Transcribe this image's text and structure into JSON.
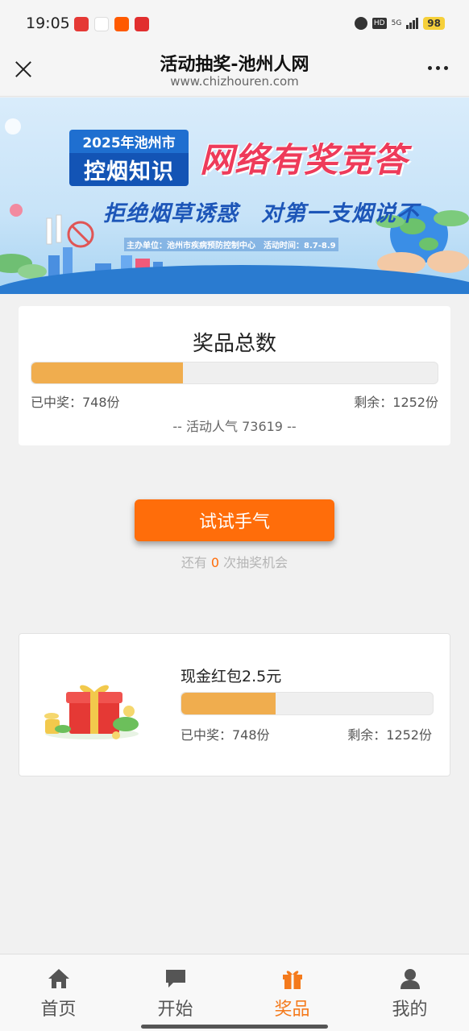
{
  "status_bar": {
    "time": "19:05",
    "network": "5G",
    "battery": "98",
    "hd": "HD",
    "app_icons": [
      "toutiao-icon",
      "app-avatar-icon",
      "taobao-icon",
      "stock-app-icon"
    ]
  },
  "header": {
    "title": "活动抽奖-池州人网",
    "subtitle": "www.chizhouren.com"
  },
  "banner": {
    "year_line": "2025年池州市",
    "badge_main": "控烟知识",
    "headline": "网络有奖竞答",
    "slogan": "拒绝烟草诱惑　对第一支烟说不",
    "info": "主办单位：池州市疾病预防控制中心　活动时间：8.7-8.9"
  },
  "prize_total": {
    "title": "奖品总数",
    "won_label": "已中奖：748份",
    "remaining_label": "剩余：1252份",
    "popularity_label": "-- 活动人气  73619 --",
    "progress": 0.374
  },
  "draw": {
    "button_label": "试试手气",
    "chances_prefix": "还有 ",
    "chances_count": "0",
    "chances_suffix": " 次抽奖机会"
  },
  "prize_item": {
    "name": "现金红包2.5元",
    "won_label": "已中奖：748份",
    "remaining_label": "剩余：1252份",
    "progress": 0.374
  },
  "tabs": [
    {
      "label": "首页",
      "icon": "home-icon"
    },
    {
      "label": "开始",
      "icon": "chat-icon"
    },
    {
      "label": "奖品",
      "icon": "gift-icon",
      "active": true
    },
    {
      "label": "我的",
      "icon": "user-icon"
    }
  ],
  "colors": {
    "accent": "#ff6d0a",
    "progress_fill": "#f0ad4e",
    "active_tab": "#f47a1c",
    "banner_blue": "#1354b5",
    "banner_pink": "#ee3b5a"
  }
}
